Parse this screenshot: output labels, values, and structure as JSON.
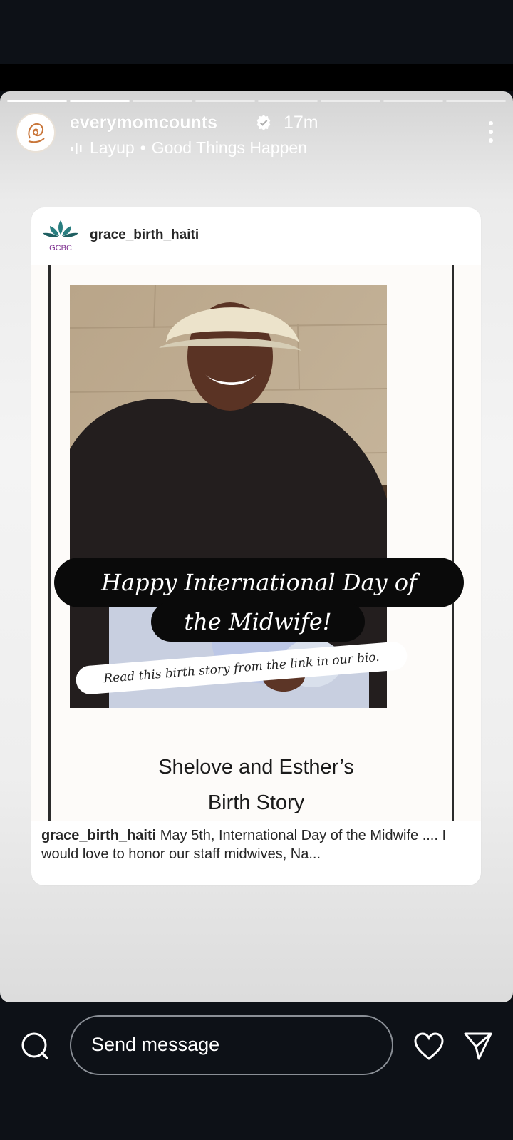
{
  "story": {
    "segments_total": 8,
    "segments_done": 2,
    "username": "everymomcounts",
    "time": "17m",
    "music": {
      "artist": "Layup",
      "separator": "•",
      "song": "Good Things Happen"
    }
  },
  "card": {
    "username": "grace_birth_haiti",
    "logo_text": "GCBC",
    "banner_line1": "Happy International Day of",
    "banner_line2": "the Midwife!",
    "ribbon_text": "Read this birth story from the link in our bio.",
    "title_line1": "Shelove and Esther’s",
    "title_line2": "Birth Story",
    "caption_user": "grace_birth_haiti",
    "caption_text": "May 5th, International Day of the Midwife .... I would love to honor our staff midwives, Na..."
  },
  "bottom": {
    "message_placeholder": "Send message"
  },
  "icons": {
    "camera": "search-camera-icon",
    "heart": "heart-icon",
    "send": "send-icon",
    "more": "more-vertical-icon",
    "verified": "verified-badge-icon",
    "audio": "audio-bars-icon"
  },
  "colors": {
    "background": "#0d1117",
    "banner": "#0a0a0a"
  }
}
